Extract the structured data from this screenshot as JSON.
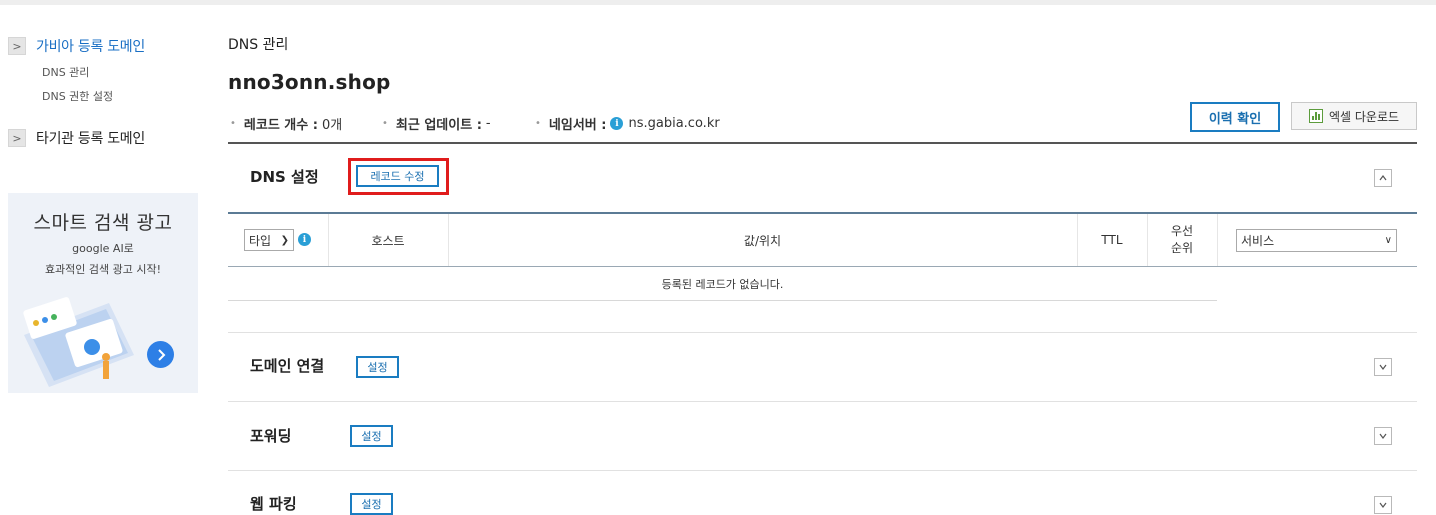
{
  "sidebar": {
    "items": [
      {
        "label": "가비아 등록 도메인",
        "active": true
      },
      {
        "label": "타기관 등록 도메인",
        "active": false
      }
    ],
    "subitems": [
      {
        "label": "DNS 관리"
      },
      {
        "label": "DNS 권한 설정"
      }
    ],
    "ad": {
      "title": "스마트 검색 광고",
      "line1": "google AI로",
      "line2": "효과적인 검색 광고 시작!"
    }
  },
  "main": {
    "breadcrumb": "DNS 관리",
    "domain": "nno3onn.shop",
    "meta": {
      "record_count_label": "레코드 개수 :",
      "record_count_value": "0개",
      "last_update_label": "최근 업데이트 :",
      "last_update_value": "-",
      "nameserver_label": "네임서버 :",
      "nameserver_value": "ns.gabia.co.kr"
    },
    "history_button": "이력 확인",
    "excel_button": "엑셀 다운로드"
  },
  "dns_section": {
    "title": "DNS 설정",
    "edit_button": "레코드 수정",
    "table": {
      "type_select": "타입",
      "host": "호스트",
      "value": "값/위치",
      "ttl": "TTL",
      "priority_line1": "우선",
      "priority_line2": "순위",
      "service_select": "서비스",
      "empty_message": "등록된 레코드가 없습니다."
    }
  },
  "sections": [
    {
      "title": "도메인 연결",
      "button": "설정"
    },
    {
      "title": "포워딩",
      "button": "설정"
    },
    {
      "title": "웹 파킹",
      "button": "설정"
    }
  ],
  "colors": {
    "accent_blue": "#1a7cc1",
    "highlight_red": "#e01c1c",
    "info_icon": "#2a9fd6"
  }
}
